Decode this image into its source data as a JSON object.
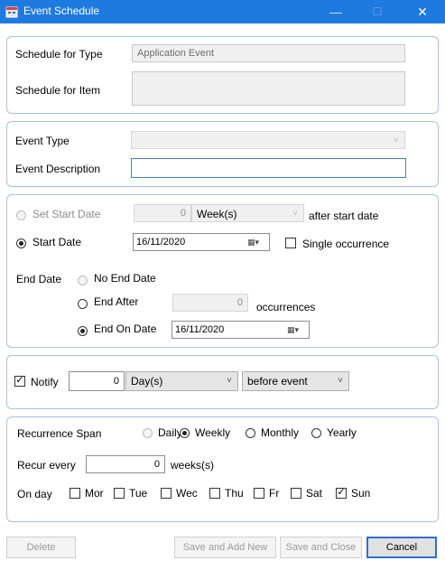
{
  "window": {
    "title": "Event Schedule",
    "minimize": "—",
    "maximize": "☐",
    "close": "✕"
  },
  "schedule": {
    "type_label": "Schedule for Type",
    "type_value": "Application Event",
    "item_label": "Schedule for Item",
    "item_value": ""
  },
  "event": {
    "type_label": "Event Type",
    "type_value": "",
    "description_label": "Event Description",
    "description_value": ""
  },
  "dates": {
    "set_start_label": "Set Start Date",
    "offset_value": "0",
    "offset_unit": "Week(s)",
    "after_start_label": "after start date",
    "start_label": "Start Date",
    "start_value": "16/11/2020",
    "single_occurrence_label": "Single occurrence",
    "end_date_label": "End Date",
    "no_end_label": "No End Date",
    "end_after_label": "End After",
    "end_after_value": "0",
    "occurrences_label": "occurrences",
    "end_on_label": "End On Date",
    "end_on_value": "16/11/2020"
  },
  "notify": {
    "label": "Notify",
    "value": "0",
    "unit": "Day(s)",
    "timing": "before event"
  },
  "recurrence": {
    "span_label": "Recurrence Span",
    "daily": "Daily",
    "weekly": "Weekly",
    "monthly": "Monthly",
    "yearly": "Yearly",
    "recur_label": "Recur every",
    "recur_value": "0",
    "recur_unit": "weeks(s)",
    "on_day_label": "On day",
    "days": [
      "Mor",
      "Tue",
      "Wec",
      "Thu",
      "Fr",
      "Sat",
      "Sun"
    ]
  },
  "buttons": {
    "delete": "Delete",
    "save_add_new": "Save and Add New",
    "save_close": "Save and Close",
    "cancel": "Cancel"
  },
  "colors": {
    "titlebar": "#1f7ae0",
    "group_border": "#a9c2dd",
    "focus_border": "#3c7fd1"
  }
}
